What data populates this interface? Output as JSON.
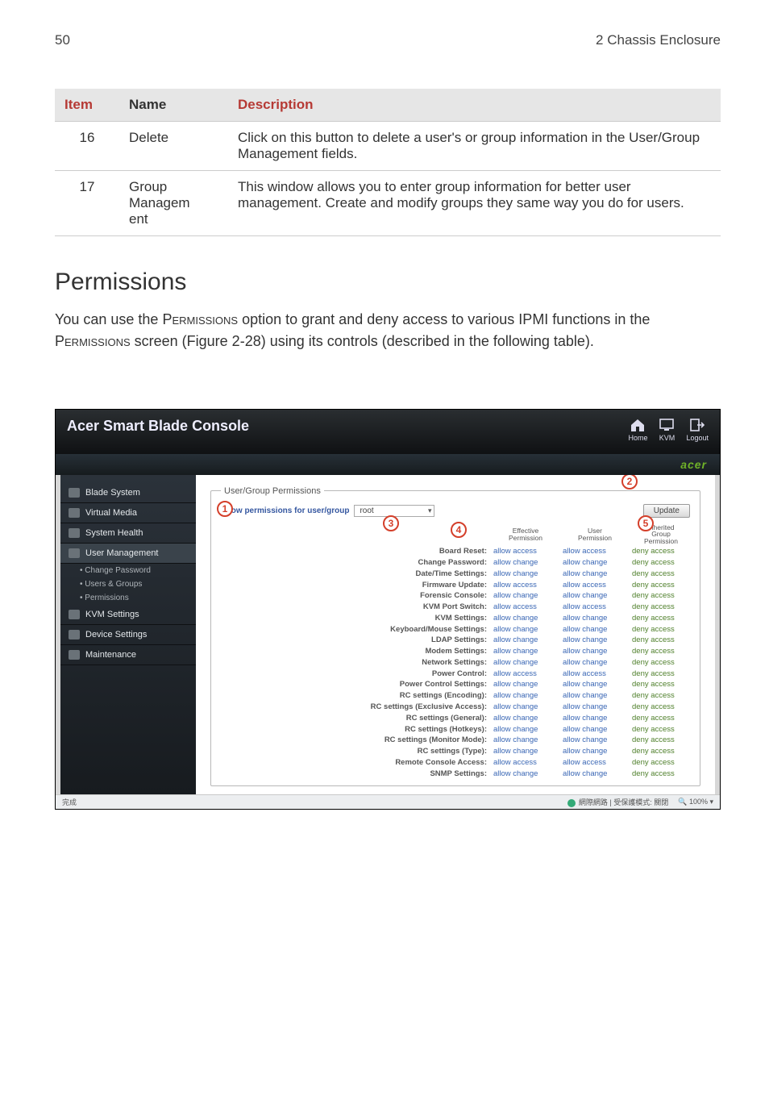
{
  "page": {
    "number": "50",
    "chapter": "2 Chassis Enclosure"
  },
  "table": {
    "headers": [
      "Item",
      "Name",
      "Description"
    ],
    "rows": [
      {
        "item": "16",
        "name": "Delete",
        "desc": "Click on this button to delete a user's or group information in the User/Group Management fields."
      },
      {
        "item": "17",
        "name": "Group Managem ent",
        "desc": "This window allows you to enter group information for better user management. Create and modify groups they same way you do for users."
      }
    ]
  },
  "section": {
    "title": "Permissions",
    "body_before": "You can use the ",
    "body_sc1": "Permissions",
    "body_mid1": " option to grant and deny access to various IPMI functions in the ",
    "body_sc2": "Permissions",
    "body_mid2": " screen (Figure 2-28) using its controls (described in the following table)."
  },
  "console": {
    "title": "Acer Smart Blade Console",
    "icons": {
      "home": "Home",
      "kvm": "KVM",
      "logout": "Logout"
    },
    "brand": "acer",
    "nav": [
      {
        "label": "Blade System"
      },
      {
        "label": "Virtual Media"
      },
      {
        "label": "System Health"
      },
      {
        "label": "User Management",
        "selected": true,
        "subs": [
          "• Change Password",
          "• Users & Groups",
          "• Permissions"
        ]
      },
      {
        "label": "KVM Settings"
      },
      {
        "label": "Device Settings"
      },
      {
        "label": "Maintenance"
      }
    ],
    "fieldset_legend": "User/Group Permissions",
    "show_label": "Show permissions for user/group",
    "show_value": "root",
    "update_btn": "Update",
    "col_headers": {
      "c1a": "Effective",
      "c1b": "Permission",
      "c2a": "User",
      "c2b": "Permission",
      "c3a": "Inherited",
      "c3b": "Group",
      "c3c": "Permission"
    },
    "rows": [
      {
        "n": "Board Reset:",
        "a": "allow access",
        "b": "allow access",
        "g": "deny access"
      },
      {
        "n": "Change Password:",
        "a": "allow change",
        "b": "allow change",
        "g": "deny access"
      },
      {
        "n": "Date/Time Settings:",
        "a": "allow change",
        "b": "allow change",
        "g": "deny access"
      },
      {
        "n": "Firmware Update:",
        "a": "allow access",
        "b": "allow access",
        "g": "deny access"
      },
      {
        "n": "Forensic Console:",
        "a": "allow change",
        "b": "allow change",
        "g": "deny access"
      },
      {
        "n": "KVM Port Switch:",
        "a": "allow access",
        "b": "allow access",
        "g": "deny access"
      },
      {
        "n": "KVM Settings:",
        "a": "allow change",
        "b": "allow change",
        "g": "deny access"
      },
      {
        "n": "Keyboard/Mouse Settings:",
        "a": "allow change",
        "b": "allow change",
        "g": "deny access"
      },
      {
        "n": "LDAP Settings:",
        "a": "allow change",
        "b": "allow change",
        "g": "deny access"
      },
      {
        "n": "Modem Settings:",
        "a": "allow change",
        "b": "allow change",
        "g": "deny access"
      },
      {
        "n": "Network Settings:",
        "a": "allow change",
        "b": "allow change",
        "g": "deny access"
      },
      {
        "n": "Power Control:",
        "a": "allow access",
        "b": "allow access",
        "g": "deny access"
      },
      {
        "n": "Power Control Settings:",
        "a": "allow change",
        "b": "allow change",
        "g": "deny access"
      },
      {
        "n": "RC settings (Encoding):",
        "a": "allow change",
        "b": "allow change",
        "g": "deny access"
      },
      {
        "n": "RC settings (Exclusive Access):",
        "a": "allow change",
        "b": "allow change",
        "g": "deny access"
      },
      {
        "n": "RC settings (General):",
        "a": "allow change",
        "b": "allow change",
        "g": "deny access"
      },
      {
        "n": "RC settings (Hotkeys):",
        "a": "allow change",
        "b": "allow change",
        "g": "deny access"
      },
      {
        "n": "RC settings (Monitor Mode):",
        "a": "allow change",
        "b": "allow change",
        "g": "deny access"
      },
      {
        "n": "RC settings (Type):",
        "a": "allow change",
        "b": "allow change",
        "g": "deny access"
      },
      {
        "n": "Remote Console Access:",
        "a": "allow access",
        "b": "allow access",
        "g": "deny access"
      },
      {
        "n": "SNMP Settings:",
        "a": "allow change",
        "b": "allow change",
        "g": "deny access"
      }
    ],
    "status": {
      "left": "完成",
      "mid": "網際網路 | 受保護模式: 關閉",
      "zoom": "100%"
    }
  },
  "bubbles": [
    "1",
    "2",
    "3",
    "4",
    "5"
  ]
}
